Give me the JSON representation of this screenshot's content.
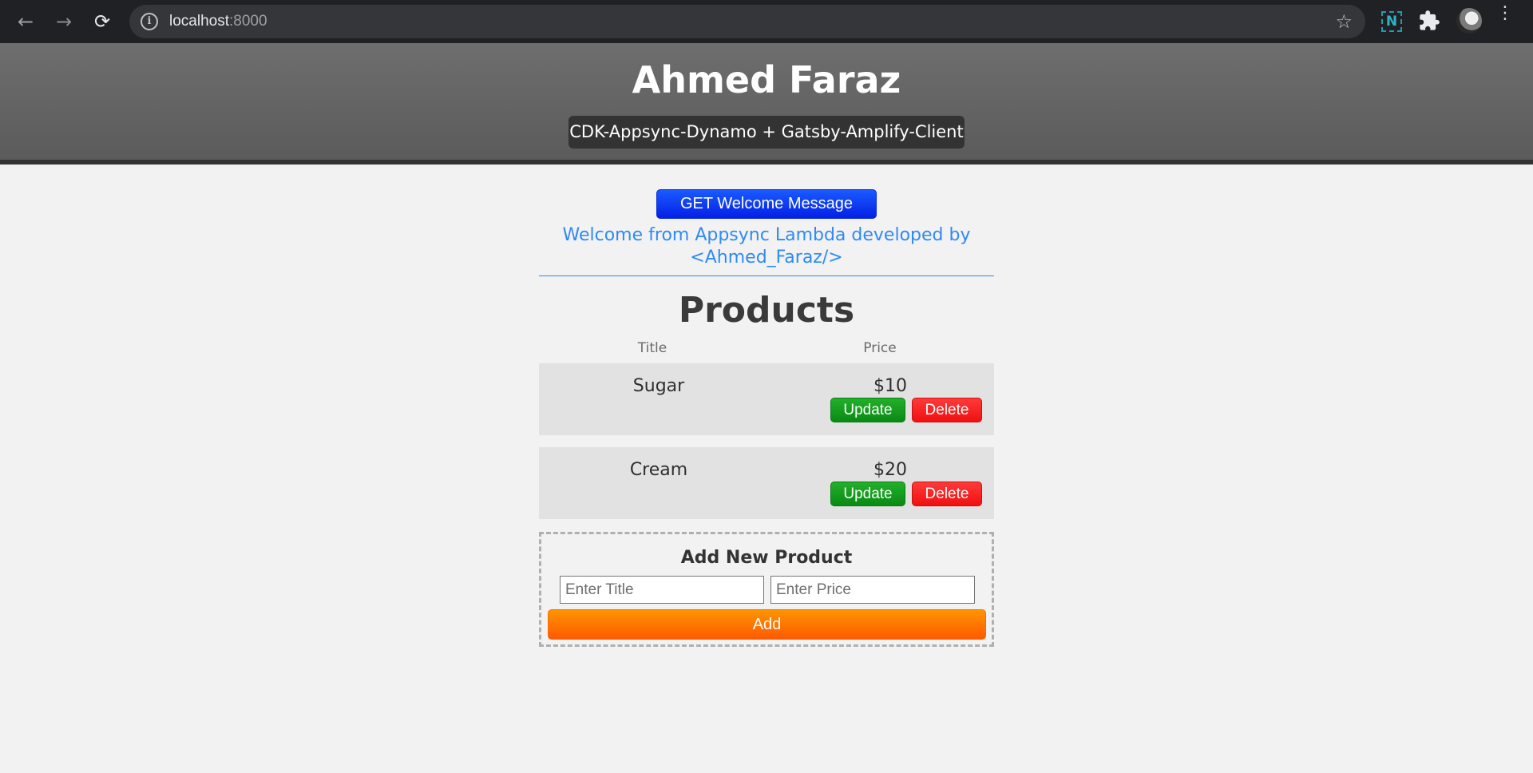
{
  "browser": {
    "back_glyph": "←",
    "forward_glyph": "→",
    "reload_glyph": "⟳",
    "info_glyph": "i",
    "url_host": "localhost",
    "url_port": ":8000",
    "star_glyph": "☆",
    "extension_label": "N",
    "menu_glyph": "⋮"
  },
  "header": {
    "title": "Ahmed Faraz",
    "subtitle": "CDK-Appsync-Dynamo + Gatsby-Amplify-Client"
  },
  "welcome": {
    "button_label": "GET Welcome Message",
    "message": "Welcome from Appsync Lambda developed by <Ahmed_Faraz/>"
  },
  "products": {
    "heading": "Products",
    "columns": [
      "Title",
      "Price"
    ],
    "items": [
      {
        "title": "Sugar",
        "price": "$10",
        "update_label": "Update",
        "delete_label": "Delete"
      },
      {
        "title": "Cream",
        "price": "$20",
        "update_label": "Update",
        "delete_label": "Delete"
      }
    ]
  },
  "add_product": {
    "heading": "Add New Product",
    "title_placeholder": "Enter Title",
    "price_placeholder": "Enter Price",
    "button_label": "Add"
  },
  "colors": {
    "welcome_button": "#0a2bd6",
    "welcome_text": "#2e8af6",
    "update_button": "#0a8a14",
    "delete_button": "#f01010",
    "add_button": "#ff6a00"
  }
}
